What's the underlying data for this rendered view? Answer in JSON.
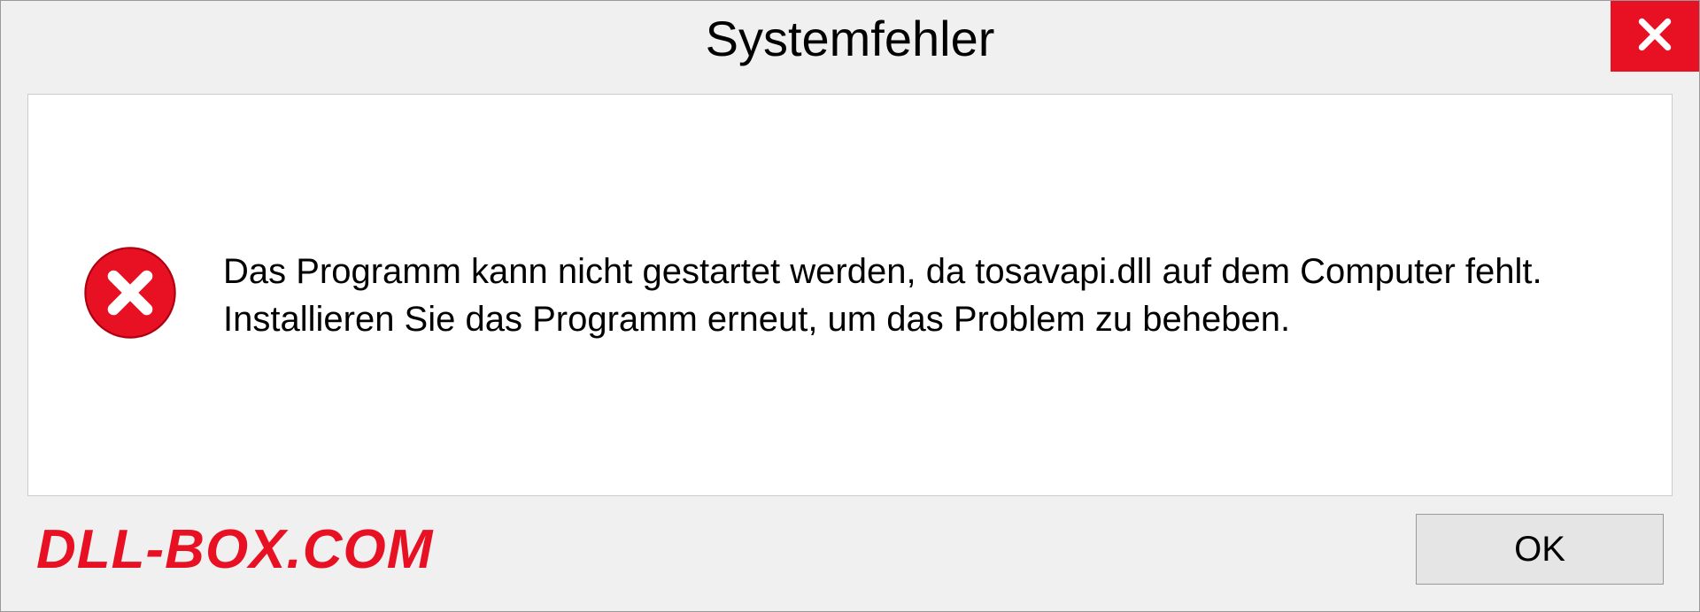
{
  "dialog": {
    "title": "Systemfehler",
    "message": "Das Programm kann nicht gestartet werden, da tosavapi.dll auf dem Computer fehlt. Installieren Sie das Programm erneut, um das Problem zu beheben.",
    "ok_label": "OK"
  },
  "watermark": "DLL-BOX.COM",
  "colors": {
    "error_red": "#e81123",
    "close_red": "#e81123"
  }
}
